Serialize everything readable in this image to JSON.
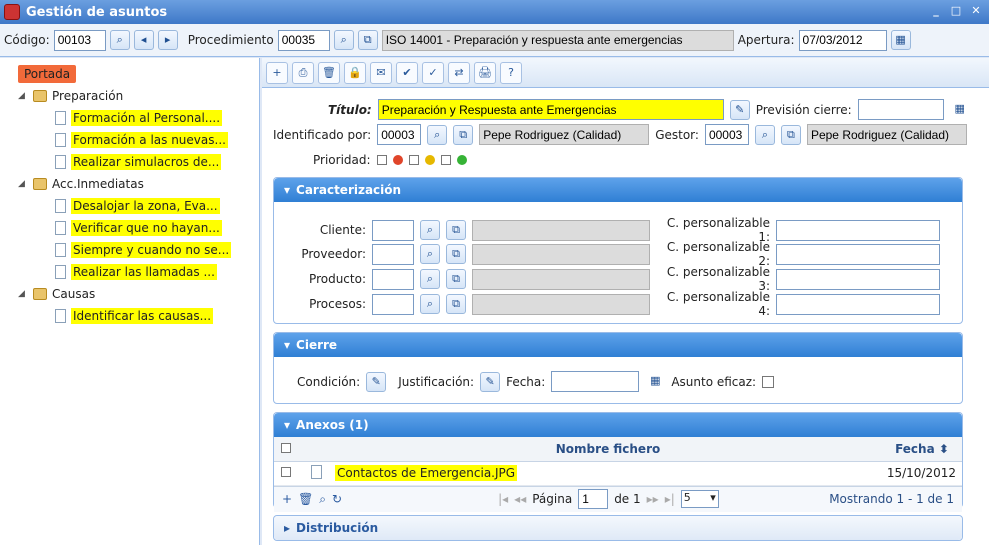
{
  "window": {
    "title": "Gestión de asuntos",
    "controls": [
      "_",
      "□",
      "✕"
    ]
  },
  "header": {
    "codigo_label": "Código:",
    "codigo_value": "00103",
    "procedimiento_label": "Procedimiento",
    "procedimiento_value": "00035",
    "procedimiento_name": "ISO 14001 - Preparación y respuesta ante emergencias",
    "apertura_label": "Apertura:",
    "apertura_value": "07/03/2012"
  },
  "tree": {
    "root": "Portada",
    "groups": [
      {
        "label": "Preparación",
        "items": [
          "Formación al Personal....",
          "Formación a las nuevas...",
          "Realizar simulacros de..."
        ]
      },
      {
        "label": "Acc.Inmediatas",
        "items": [
          "Desalojar la zona, Eva...",
          "Verificar que no hayan...",
          "Siempre y cuando no se...",
          "Realizar las llamadas ..."
        ]
      },
      {
        "label": "Causas",
        "items": [
          "Identificar las causas..."
        ]
      }
    ]
  },
  "toolbar": {
    "icons": [
      "+",
      "⎙",
      "🗑",
      "🔒",
      "✉",
      "✔",
      "✓",
      "⇄",
      "🖨",
      "?"
    ]
  },
  "form": {
    "titulo_label": "Título:",
    "titulo_value": "Preparación y Respuesta ante Emergencias",
    "prevision_label": "Previsión cierre:",
    "identificado_label": "Identificado por:",
    "identificado_code": "00003",
    "identificado_name": "Pepe Rodriguez (Calidad)",
    "gestor_label": "Gestor:",
    "gestor_code": "00003",
    "gestor_name": "Pepe Rodriguez (Calidad)",
    "prioridad_label": "Prioridad:"
  },
  "caracterizacion": {
    "title": "Caracterización",
    "rows": [
      {
        "label": "Cliente:",
        "custom": "C. personalizable 1:"
      },
      {
        "label": "Proveedor:",
        "custom": "C. personalizable 2:"
      },
      {
        "label": "Producto:",
        "custom": "C. personalizable 3:"
      },
      {
        "label": "Procesos:",
        "custom": "C. personalizable 4:"
      }
    ]
  },
  "cierre": {
    "title": "Cierre",
    "condicion_label": "Condición:",
    "justificacion_label": "Justificación:",
    "fecha_label": "Fecha:",
    "eficaz_label": "Asunto eficaz:"
  },
  "anexos": {
    "title": "Anexos (1)",
    "col_nombre": "Nombre fichero",
    "col_fecha": "Fecha",
    "files": [
      {
        "name": "Contactos de Emergencia.JPG",
        "date": "15/10/2012"
      }
    ],
    "pagina_label": "Página",
    "page": "1",
    "de_label": "de 1",
    "per_page": "5",
    "status": "Mostrando 1 - 1 de 1"
  },
  "distribucion": {
    "title": "Distribución"
  },
  "colors": {
    "accent": "#2f7fd4",
    "highlight": "#ffff00",
    "portada": "#f26a3a"
  }
}
